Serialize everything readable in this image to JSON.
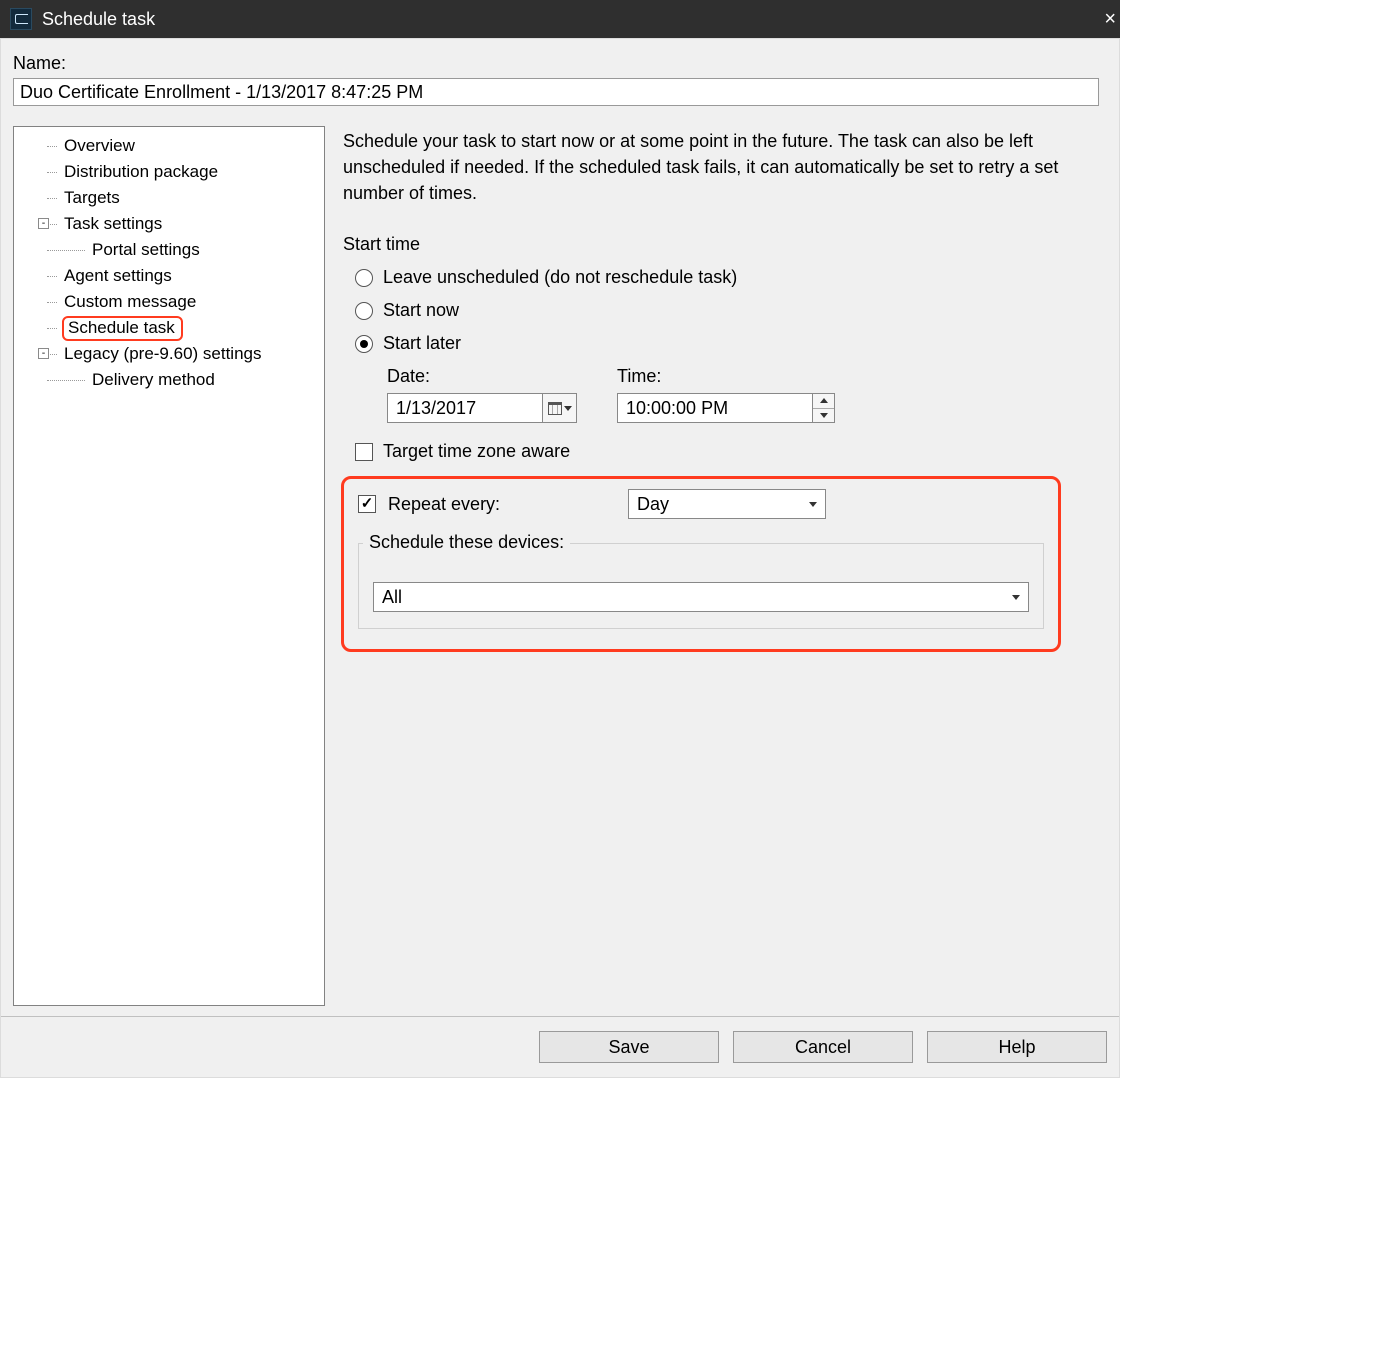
{
  "window": {
    "title": "Schedule task"
  },
  "name_section": {
    "label": "Name:",
    "value": "Duo Certificate Enrollment - 1/13/2017 8:47:25 PM"
  },
  "tree": {
    "items": [
      {
        "label": "Overview"
      },
      {
        "label": "Distribution package"
      },
      {
        "label": "Targets"
      },
      {
        "label": "Task settings",
        "expander": "-",
        "children": [
          {
            "label": "Portal settings"
          }
        ]
      },
      {
        "label": "Agent settings"
      },
      {
        "label": "Custom message"
      },
      {
        "label": "Schedule task",
        "selected": true
      },
      {
        "label": "Legacy (pre-9.60) settings",
        "expander": "-",
        "children": [
          {
            "label": "Delivery method"
          }
        ]
      }
    ]
  },
  "content": {
    "description": "Schedule your task to start now or at some point in the future.  The task can also be left unscheduled if needed.  If the scheduled task fails, it can automatically be set to retry a set number of times.",
    "start_time_label": "Start time",
    "radios": {
      "leave_unscheduled": "Leave unscheduled (do not reschedule task)",
      "start_now": "Start now",
      "start_later": "Start later",
      "selected": "start_later"
    },
    "date": {
      "label": "Date:",
      "value": "1/13/2017"
    },
    "time": {
      "label": "Time:",
      "value": "10:00:00 PM"
    },
    "target_tz": {
      "label": "Target time zone aware",
      "checked": false
    },
    "repeat": {
      "label": "Repeat every:",
      "checked": true,
      "value": "Day"
    },
    "schedule_devices": {
      "legend": "Schedule these devices:",
      "value": "All"
    }
  },
  "buttons": {
    "save": "Save",
    "cancel": "Cancel",
    "help": "Help"
  }
}
